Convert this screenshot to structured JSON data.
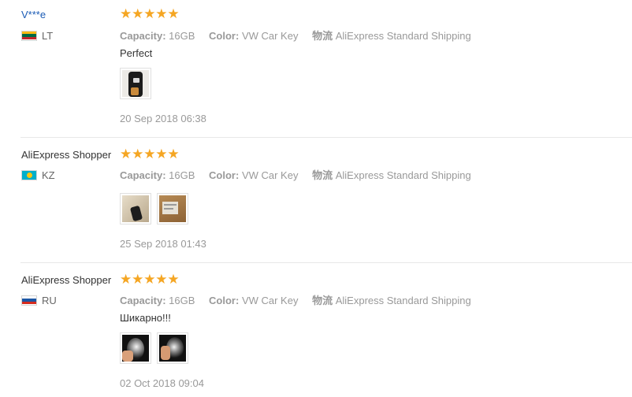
{
  "reviews": [
    {
      "user": "V***e",
      "country_code": "LT",
      "flag": "lithuania",
      "rating": 5,
      "attributes": {
        "capacity_label": "Capacity:",
        "capacity_value": "16GB",
        "color_label": "Color:",
        "color_value": "VW Car Key",
        "logistics_label": "物流",
        "logistics_value": "AliExpress Standard Shipping"
      },
      "comment": "Perfect",
      "photos": 1,
      "date": "20 Sep 2018 06:38"
    },
    {
      "user": "AliExpress Shopper",
      "country_code": "KZ",
      "flag": "kazakhstan",
      "rating": 5,
      "attributes": {
        "capacity_label": "Capacity:",
        "capacity_value": "16GB",
        "color_label": "Color:",
        "color_value": "VW Car Key",
        "logistics_label": "物流",
        "logistics_value": "AliExpress Standard Shipping"
      },
      "comment": "",
      "photos": 2,
      "date": "25 Sep 2018 01:43"
    },
    {
      "user": "AliExpress Shopper",
      "country_code": "RU",
      "flag": "russia",
      "rating": 5,
      "attributes": {
        "capacity_label": "Capacity:",
        "capacity_value": "16GB",
        "color_label": "Color:",
        "color_value": "VW Car Key",
        "logistics_label": "物流",
        "logistics_value": "AliExpress Standard Shipping"
      },
      "comment": "Шикарно!!!",
      "photos": 2,
      "date": "02 Oct 2018 09:04"
    }
  ],
  "colors": {
    "star": "#f5a623",
    "username_link": "#1a5bb5",
    "muted_text": "#999999"
  }
}
